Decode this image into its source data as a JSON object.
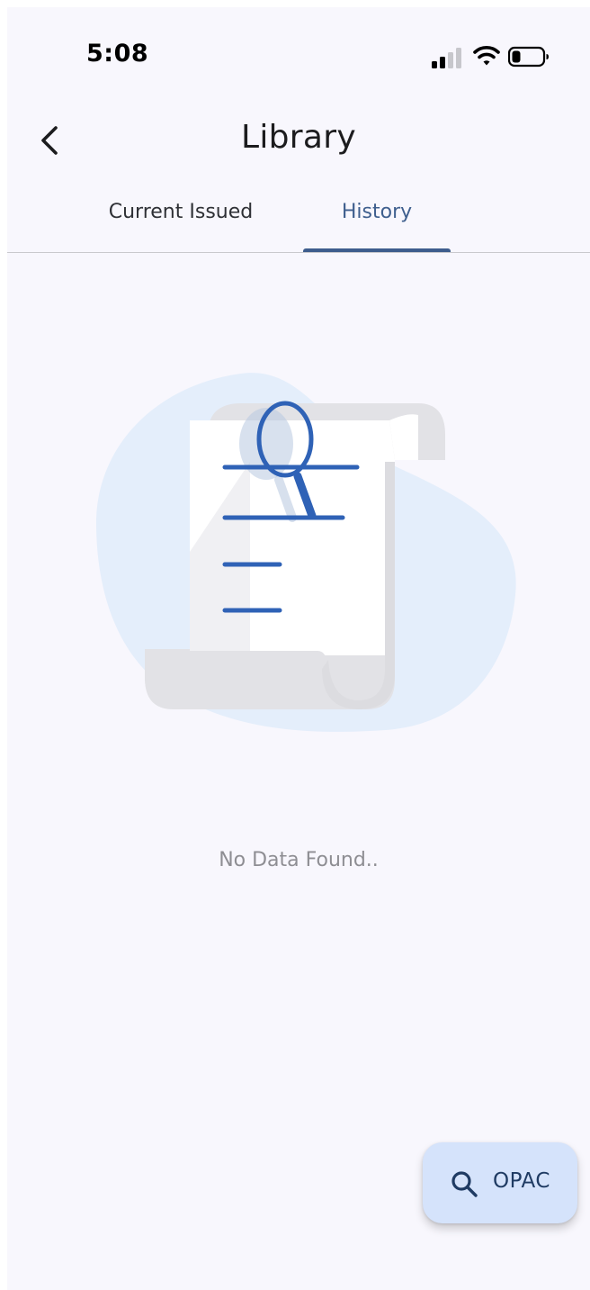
{
  "status_bar": {
    "time": "5:08",
    "icons": [
      "signal-icon",
      "wifi-icon",
      "battery-icon"
    ]
  },
  "header": {
    "title": "Library",
    "back_icon": "chevron-left-icon"
  },
  "tabs": [
    {
      "label": "Current Issued",
      "selected": false
    },
    {
      "label": "History",
      "selected": true
    }
  ],
  "empty_state": {
    "illustration": "document-scroll-search-icon",
    "message": "No Data Found.."
  },
  "fab": {
    "label": "OPAC",
    "icon": "search-icon"
  },
  "colors": {
    "background": "#f8f7fd",
    "accent": "#3e5d8d",
    "illustration_blue": "#2f62b6",
    "blob": "#e4eefb",
    "fab_background": "#d5e3fb"
  }
}
